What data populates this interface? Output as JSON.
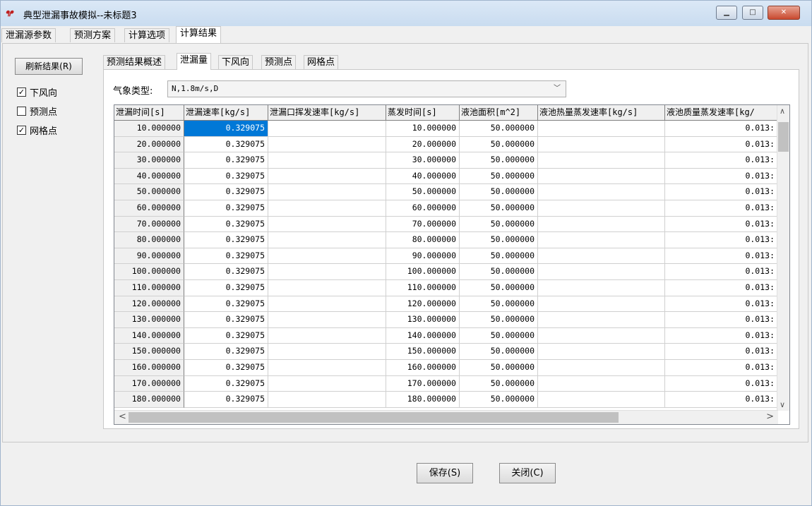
{
  "window": {
    "icon_text": "ᖳᖰ",
    "title": "典型泄漏事故模拟--未标题3",
    "minimize_label": "▁",
    "maximize_label": "□",
    "close_label": "✕"
  },
  "main_tabs": [
    "泄漏源参数",
    "预测方案",
    "计算选项",
    "计算结果"
  ],
  "left": {
    "refresh_label": "刷新结果(R)",
    "checkboxes": [
      {
        "label": "下风向",
        "checked": true,
        "mark": "✓"
      },
      {
        "label": "预测点",
        "checked": false,
        "mark": ""
      },
      {
        "label": "网格点",
        "checked": true,
        "mark": "✓"
      }
    ]
  },
  "sub_tabs": [
    "预测结果概述",
    "泄漏量",
    "下风向",
    "预测点",
    "网格点"
  ],
  "weather": {
    "label": "气象类型:",
    "value": "N,1.8m/s,D",
    "dropdown_icon": "﹀"
  },
  "grid": {
    "headers": [
      "泄漏时间[s]",
      "泄漏速率[kg/s]",
      "泄漏口挥发速率[kg/s]",
      "蒸发时间[s]",
      "液池面积[m^2]",
      "液池热量蒸发速率[kg/s]",
      "液池质量蒸发速率[kg/"
    ],
    "rows": [
      [
        "10.000000",
        "0.329075",
        "",
        "10.000000",
        "50.000000",
        "",
        "0.013:"
      ],
      [
        "20.000000",
        "0.329075",
        "",
        "20.000000",
        "50.000000",
        "",
        "0.013:"
      ],
      [
        "30.000000",
        "0.329075",
        "",
        "30.000000",
        "50.000000",
        "",
        "0.013:"
      ],
      [
        "40.000000",
        "0.329075",
        "",
        "40.000000",
        "50.000000",
        "",
        "0.013:"
      ],
      [
        "50.000000",
        "0.329075",
        "",
        "50.000000",
        "50.000000",
        "",
        "0.013:"
      ],
      [
        "60.000000",
        "0.329075",
        "",
        "60.000000",
        "50.000000",
        "",
        "0.013:"
      ],
      [
        "70.000000",
        "0.329075",
        "",
        "70.000000",
        "50.000000",
        "",
        "0.013:"
      ],
      [
        "80.000000",
        "0.329075",
        "",
        "80.000000",
        "50.000000",
        "",
        "0.013:"
      ],
      [
        "90.000000",
        "0.329075",
        "",
        "90.000000",
        "50.000000",
        "",
        "0.013:"
      ],
      [
        "100.000000",
        "0.329075",
        "",
        "100.000000",
        "50.000000",
        "",
        "0.013:"
      ],
      [
        "110.000000",
        "0.329075",
        "",
        "110.000000",
        "50.000000",
        "",
        "0.013:"
      ],
      [
        "120.000000",
        "0.329075",
        "",
        "120.000000",
        "50.000000",
        "",
        "0.013:"
      ],
      [
        "130.000000",
        "0.329075",
        "",
        "130.000000",
        "50.000000",
        "",
        "0.013:"
      ],
      [
        "140.000000",
        "0.329075",
        "",
        "140.000000",
        "50.000000",
        "",
        "0.013:"
      ],
      [
        "150.000000",
        "0.329075",
        "",
        "150.000000",
        "50.000000",
        "",
        "0.013:"
      ],
      [
        "160.000000",
        "0.329075",
        "",
        "160.000000",
        "50.000000",
        "",
        "0.013:"
      ],
      [
        "170.000000",
        "0.329075",
        "",
        "170.000000",
        "50.000000",
        "",
        "0.013:"
      ],
      [
        "180.000000",
        "0.329075",
        "",
        "180.000000",
        "50.000000",
        "",
        "0.013:"
      ]
    ],
    "scroll_up": "∧",
    "scroll_down": "∨",
    "scroll_left": "<",
    "scroll_right": ">"
  },
  "buttons": {
    "save": "保存(S)",
    "close": "关闭(C)"
  }
}
